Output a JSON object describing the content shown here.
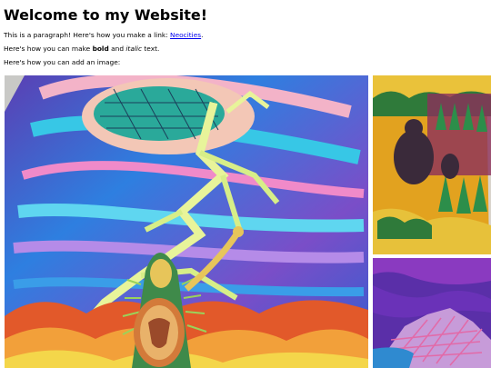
{
  "heading": "Welcome to my Website!",
  "paragraph1": {
    "text_before": "This is a paragraph! Here's how you make a link: ",
    "link_text": "Neocities",
    "text_after": "."
  },
  "paragraph2": {
    "text1": "Here's how you can make ",
    "bold": "bold",
    "text2": " and ",
    "italic": "italic",
    "text3": " text."
  },
  "paragraph3": "Here's how you can add an image:",
  "colors": {
    "link": "#0000ee",
    "background": "#ffffff"
  },
  "images": [
    {
      "name": "painting-lightning-figure",
      "subject": "psychedelic painting of a feathered figure holding a shield under a lightning-filled sky"
    },
    {
      "name": "painting-trees-portrait",
      "subject": "painting of dark figures among green trees on yellow ground"
    },
    {
      "name": "painting-purple-hand",
      "subject": "painting with purple and pink strokes and a patterned hand shape"
    }
  ]
}
